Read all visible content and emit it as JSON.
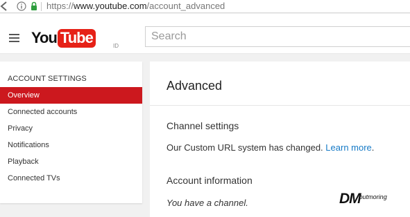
{
  "browser": {
    "url_scheme": "https://",
    "url_host": "www.youtube.com",
    "url_path": "/account_advanced"
  },
  "masthead": {
    "logo_you": "You",
    "logo_tube": "Tube",
    "logo_region": "ID",
    "search_placeholder": "Search"
  },
  "sidebar": {
    "heading": "ACCOUNT SETTINGS",
    "items": [
      {
        "label": "Overview",
        "active": true
      },
      {
        "label": "Connected accounts",
        "active": false
      },
      {
        "label": "Privacy",
        "active": false
      },
      {
        "label": "Notifications",
        "active": false
      },
      {
        "label": "Playback",
        "active": false
      },
      {
        "label": "Connected TVs",
        "active": false
      }
    ]
  },
  "main": {
    "title": "Advanced",
    "channel_settings": {
      "title": "Channel settings",
      "text": "Our Custom URL system has changed.",
      "link": "Learn more",
      "trailing": "."
    },
    "account_information": {
      "title": "Account information",
      "text": "You have a channel."
    }
  },
  "watermark": {
    "brand": "DM",
    "sub": "outmoring"
  },
  "colors": {
    "accent_red": "#cc181e",
    "logo_red": "#e62117",
    "link_blue": "#167ac6",
    "secure_green": "#2e9e3e"
  },
  "icons": [
    "back-arrow-icon",
    "info-icon",
    "lock-icon",
    "menu-icon"
  ]
}
